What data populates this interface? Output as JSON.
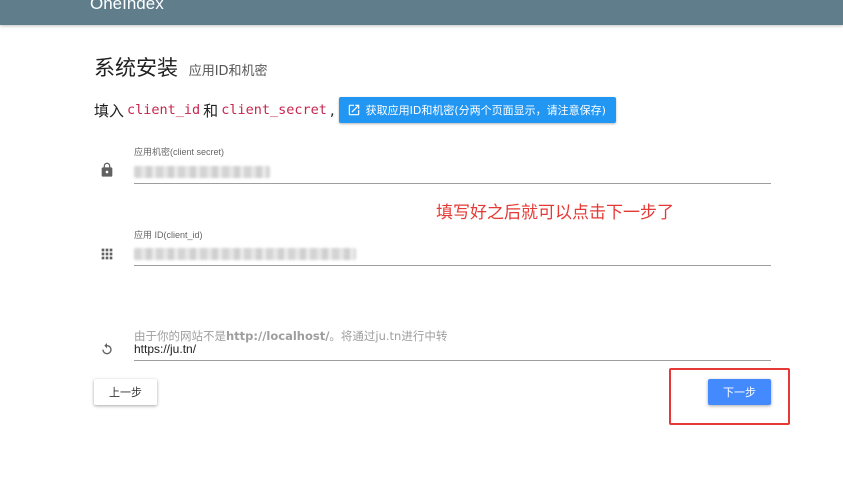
{
  "header": {
    "brand": "OneIndex"
  },
  "page": {
    "title": "系统安装",
    "subtitle": "应用ID和机密"
  },
  "instruction": {
    "prefix": "填入",
    "code1": "client_id",
    "conjunction": "和",
    "code2": "client_secret",
    "suffix": ",",
    "link_label": "获取应用ID和机密(分两个页面显示，请注意保存)"
  },
  "fields": {
    "client_secret": {
      "label": "应用机密(client secret)"
    },
    "client_id": {
      "label": "应用 ID(client_id)"
    },
    "redirect": {
      "hint_prefix": "由于你的网站不是",
      "hint_bold": "http://localhost/",
      "hint_suffix": "。将通过ju.tn进行中转",
      "value": "https://ju.tn/"
    }
  },
  "annotation": {
    "text": "填写好之后就可以点击下一步了"
  },
  "buttons": {
    "prev_label": "上一步",
    "next_label": "下一步"
  },
  "colors": {
    "header": "#607d8b",
    "primary": "#2196f3",
    "next_button": "#448aff",
    "annotation": "#e53935",
    "code": "#c7254e"
  },
  "icons": {
    "secret": "lock-icon",
    "id": "grid-icon",
    "redirect": "refresh-icon",
    "link": "open-in-new-icon"
  }
}
